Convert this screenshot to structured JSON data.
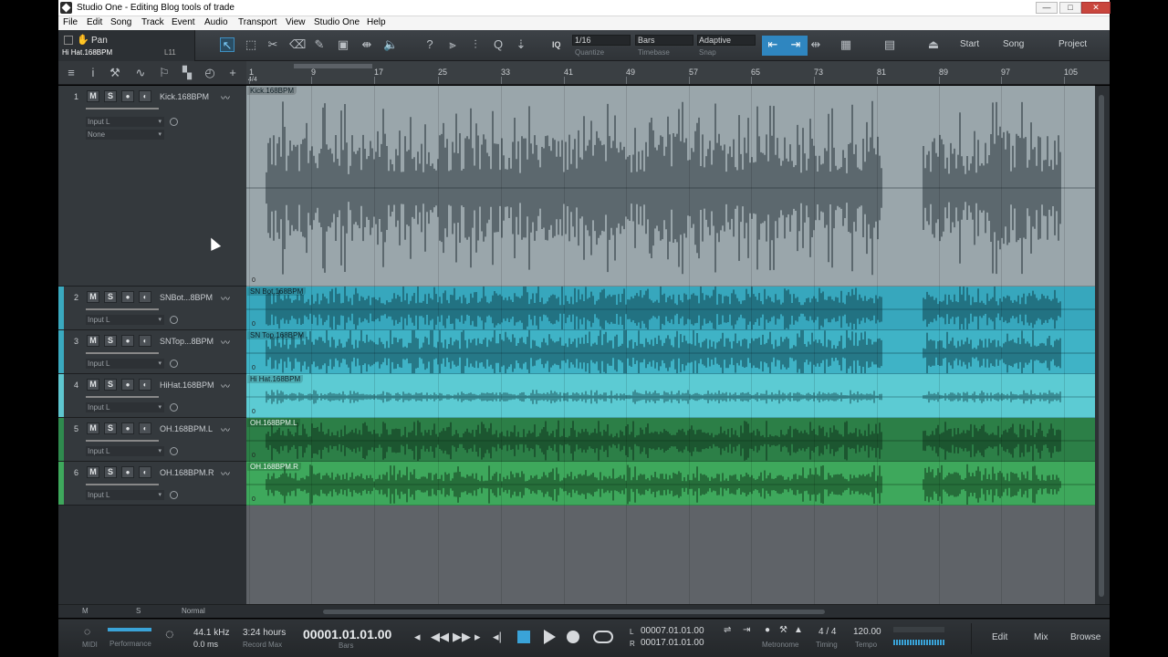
{
  "window": {
    "title": "Studio One - Editing Blog tools of trade",
    "min": "—",
    "max": "□",
    "close": "✕"
  },
  "menu": [
    "File",
    "Edit",
    "Song",
    "Track",
    "Event",
    "Audio",
    "Transport",
    "View",
    "Studio One",
    "Help"
  ],
  "toolbar": {
    "pan_label": "Pan",
    "selected_track": "Hi Hat.168BPM",
    "channel": "L11",
    "iq_label": "IQ",
    "quantize_value": "1/16",
    "quantize_label": "Quantize",
    "timebase_value": "Bars",
    "timebase_label": "Timebase",
    "snap_value": "Adaptive",
    "snap_label": "Snap",
    "start_label": "Start",
    "song_label": "Song",
    "project_label": "Project"
  },
  "ruler": {
    "ticks": [
      "1",
      "9",
      "17",
      "25",
      "33",
      "41",
      "49",
      "57",
      "65",
      "73",
      "81",
      "89",
      "97",
      "105"
    ],
    "sig": "4/4"
  },
  "tracks": [
    {
      "num": "1",
      "name": "Kick.168BPM",
      "clip": "Kick.168BPM",
      "input": "Input L",
      "output": "None",
      "color": "#9aa6ab"
    },
    {
      "num": "2",
      "name": "SNBot...8BPM",
      "clip": "SN Bot.168BPM",
      "input": "Input L",
      "color": "#3aa9bf"
    },
    {
      "num": "3",
      "name": "SNTop...8BPM",
      "clip": "SN Top.168BPM",
      "input": "Input L",
      "color": "#3aa9bf"
    },
    {
      "num": "4",
      "name": "HiHat.168BPM",
      "clip": "Hi Hat.168BPM",
      "input": "Input L",
      "color": "#5ec6cf"
    },
    {
      "num": "5",
      "name": "OH.168BPM.L",
      "clip": "OH.168BPM.L",
      "input": "Input L",
      "color": "#2f8a4e"
    },
    {
      "num": "6",
      "name": "OH.168BPM.R",
      "clip": "OH.168BPM.R",
      "input": "Input L",
      "color": "#3ea85c"
    }
  ],
  "track_buttons": {
    "mute": "M",
    "solo": "S",
    "record": "●",
    "monitor": "◐"
  },
  "arrange_bottom": {
    "m": "M",
    "s": "S",
    "mode": "Normal"
  },
  "transport": {
    "midi_label": "MIDI",
    "performance_label": "Performance",
    "sample_rate": "44.1 kHz",
    "latency": "0.0 ms",
    "record_max_value": "3:24 hours",
    "record_max_label": "Record Max",
    "position": "00001.01.01.00",
    "position_label": "Bars",
    "left_locator": "00007.01.01.00",
    "right_locator": "00017.01.01.00",
    "l_label": "L",
    "r_label": "R",
    "metronome_label": "Metronome",
    "timing_value": "4 / 4",
    "timing_label": "Timing",
    "tempo_value": "120.00",
    "tempo_label": "Tempo",
    "edit_label": "Edit",
    "mix_label": "Mix",
    "browse_label": "Browse"
  }
}
